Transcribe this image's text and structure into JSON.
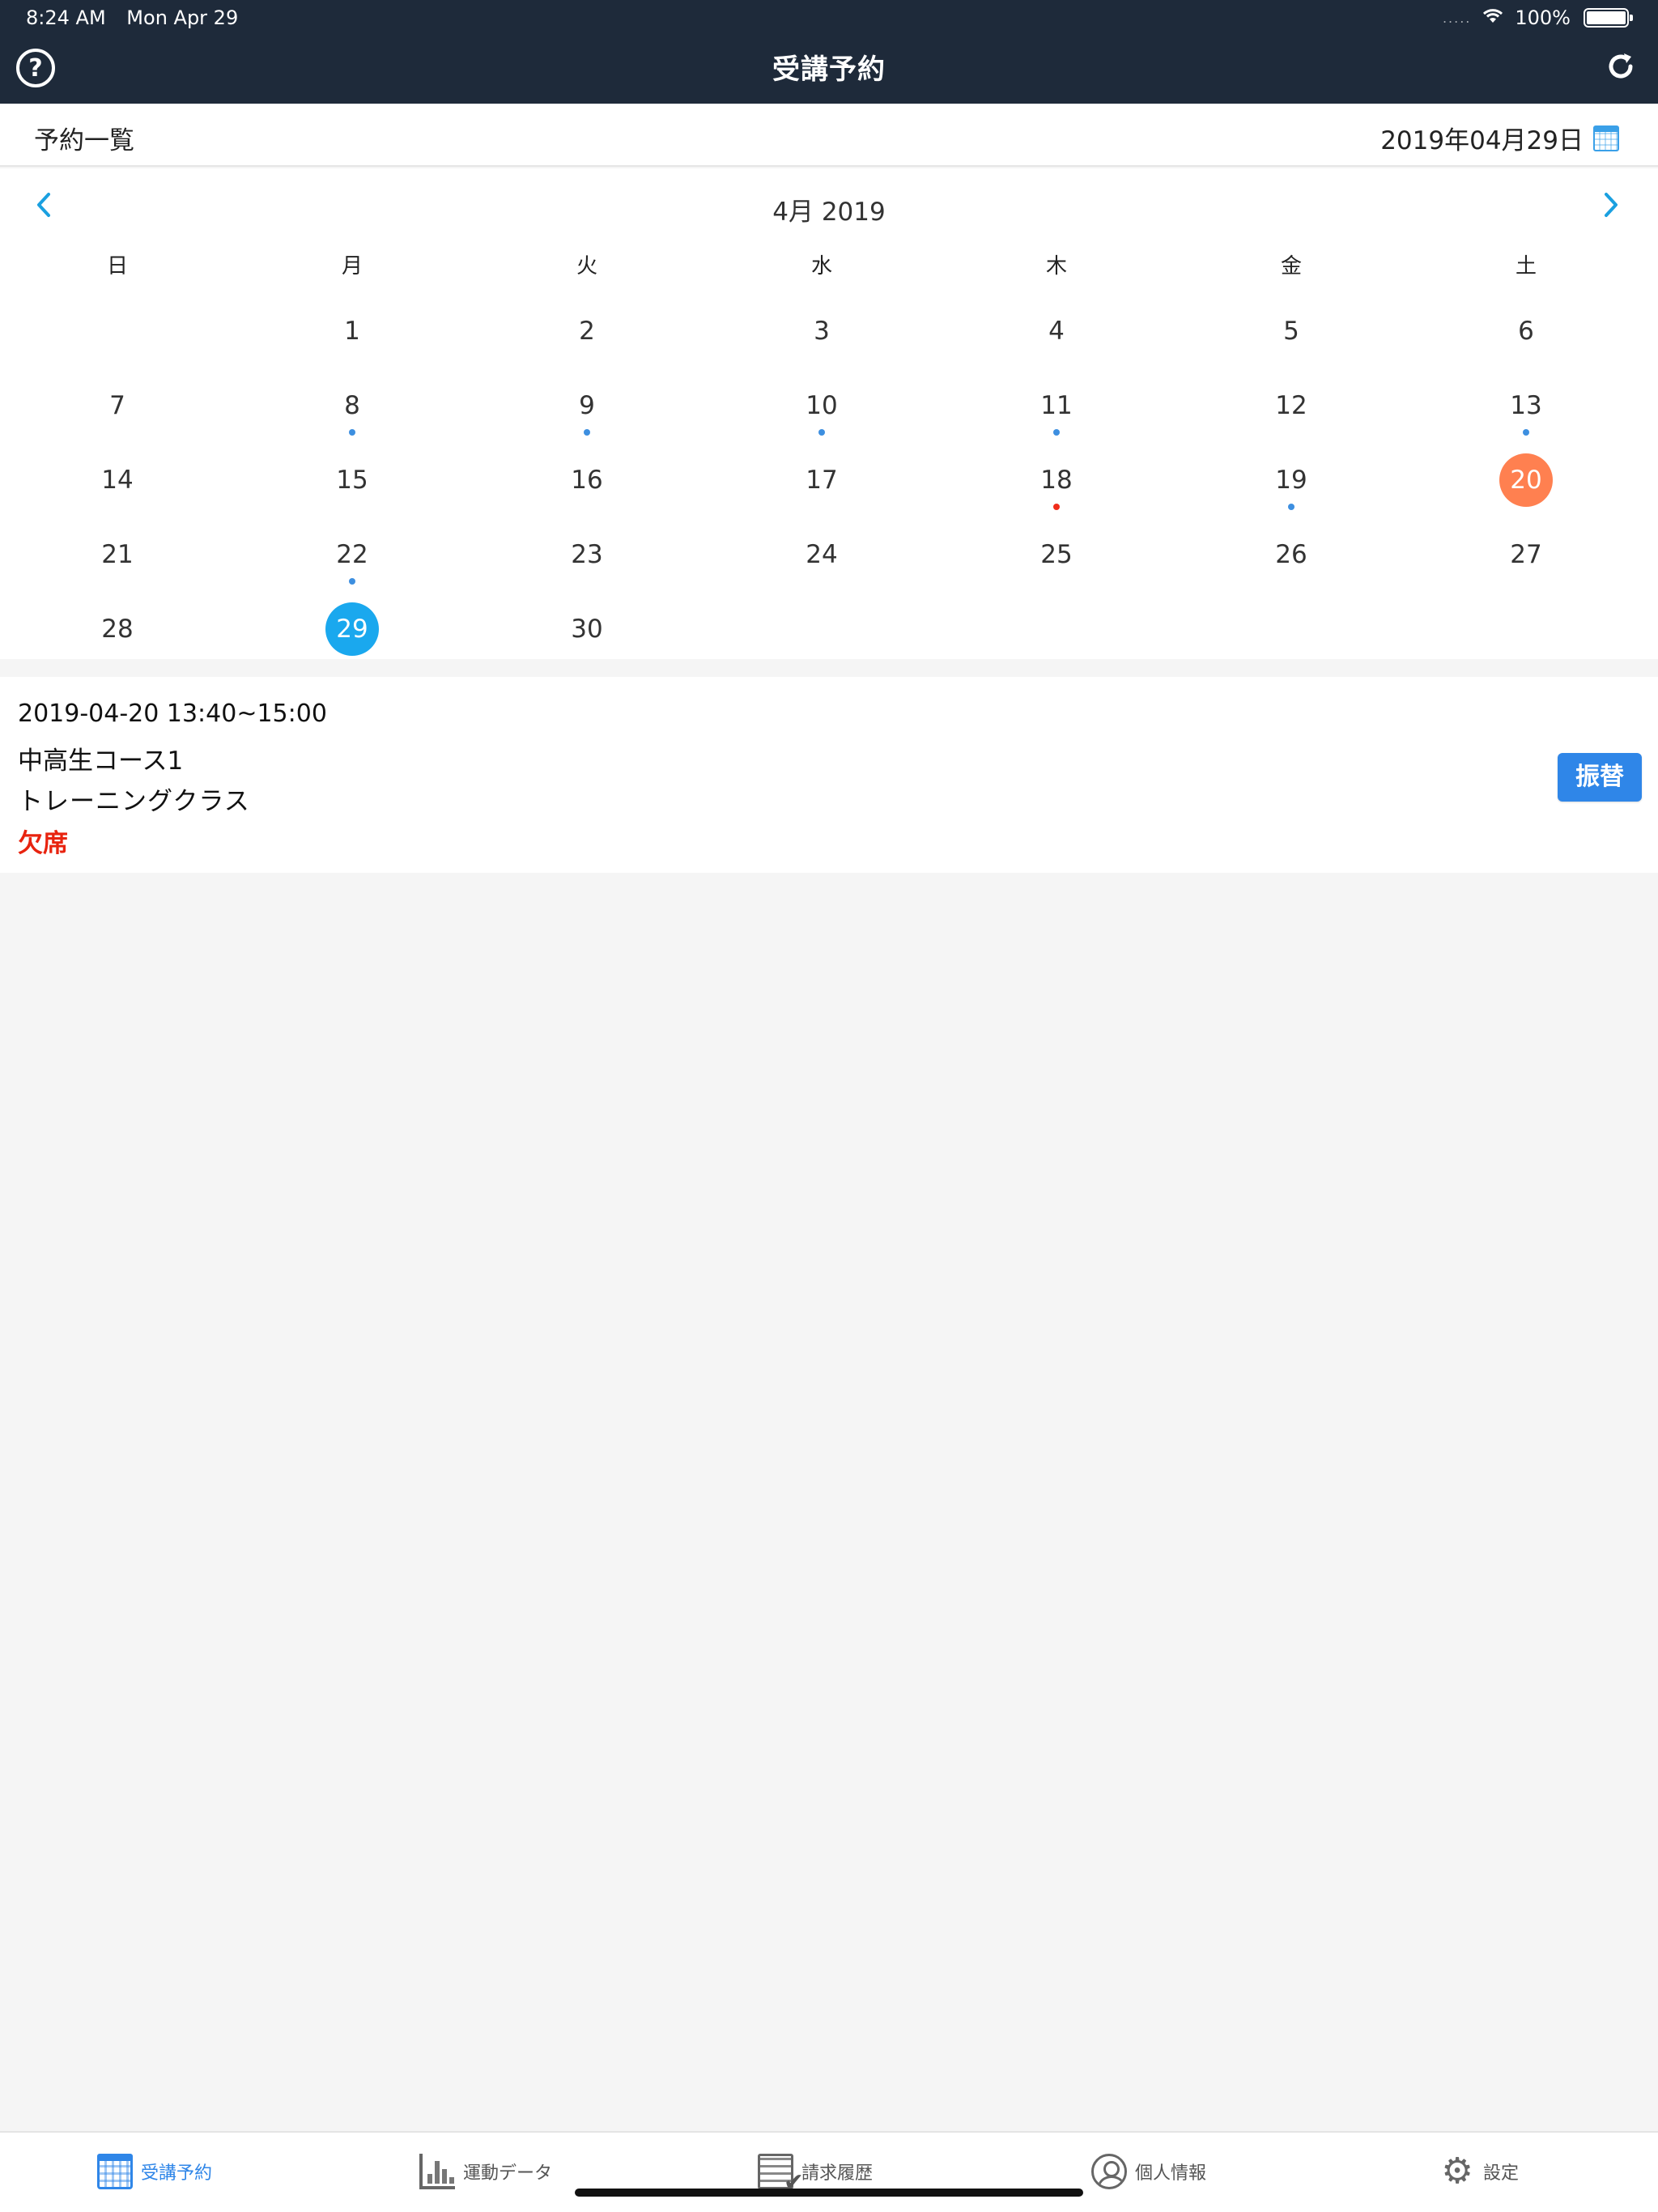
{
  "status_bar": {
    "time": "8:24 AM",
    "date": "Mon Apr 29",
    "signal": ".....",
    "battery": "100%"
  },
  "header": {
    "title": "受講予約",
    "help_icon": "help-circle-icon",
    "refresh_icon": "refresh-icon"
  },
  "subheader": {
    "title": "予約一覧",
    "selected_date": "2019年04月29日"
  },
  "calendar": {
    "month_label": "4月 2019",
    "weekdays": [
      "日",
      "月",
      "火",
      "水",
      "木",
      "金",
      "土"
    ],
    "leading_blank_days": 1,
    "days": [
      {
        "n": "1"
      },
      {
        "n": "2"
      },
      {
        "n": "3"
      },
      {
        "n": "4"
      },
      {
        "n": "5"
      },
      {
        "n": "6"
      },
      {
        "n": "7"
      },
      {
        "n": "8",
        "dot": "blue"
      },
      {
        "n": "9",
        "dot": "blue"
      },
      {
        "n": "10",
        "dot": "blue"
      },
      {
        "n": "11",
        "dot": "blue"
      },
      {
        "n": "12"
      },
      {
        "n": "13",
        "dot": "blue"
      },
      {
        "n": "14"
      },
      {
        "n": "15"
      },
      {
        "n": "16"
      },
      {
        "n": "17"
      },
      {
        "n": "18",
        "dot": "red"
      },
      {
        "n": "19",
        "dot": "blue"
      },
      {
        "n": "20",
        "highlight": "orange"
      },
      {
        "n": "21"
      },
      {
        "n": "22",
        "dot": "blue"
      },
      {
        "n": "23"
      },
      {
        "n": "24"
      },
      {
        "n": "25"
      },
      {
        "n": "26"
      },
      {
        "n": "27"
      },
      {
        "n": "28"
      },
      {
        "n": "29",
        "highlight": "blue"
      },
      {
        "n": "30"
      }
    ]
  },
  "reservation": {
    "datetime": "2019-04-20  13:40~15:00",
    "course": "中高生コース1",
    "class_name": "トレーニングクラス",
    "status": "欠席",
    "transfer_label": "振替"
  },
  "tabbar": {
    "tabs": [
      {
        "label": "受講予約",
        "icon": "calendar-icon",
        "active": true
      },
      {
        "label": "運動データ",
        "icon": "bar-chart-icon",
        "active": false
      },
      {
        "label": "請求履歴",
        "icon": "invoice-check-icon",
        "active": false
      },
      {
        "label": "個人情報",
        "icon": "person-icon",
        "active": false
      },
      {
        "label": "設定",
        "icon": "gear-icon",
        "active": false
      }
    ]
  },
  "colors": {
    "header_bg": "#1e2a3a",
    "accent_blue": "#2f86e8",
    "today_blue": "#1aa8ee",
    "highlight_orange": "#ff8050",
    "absent_red": "#e8230f"
  }
}
